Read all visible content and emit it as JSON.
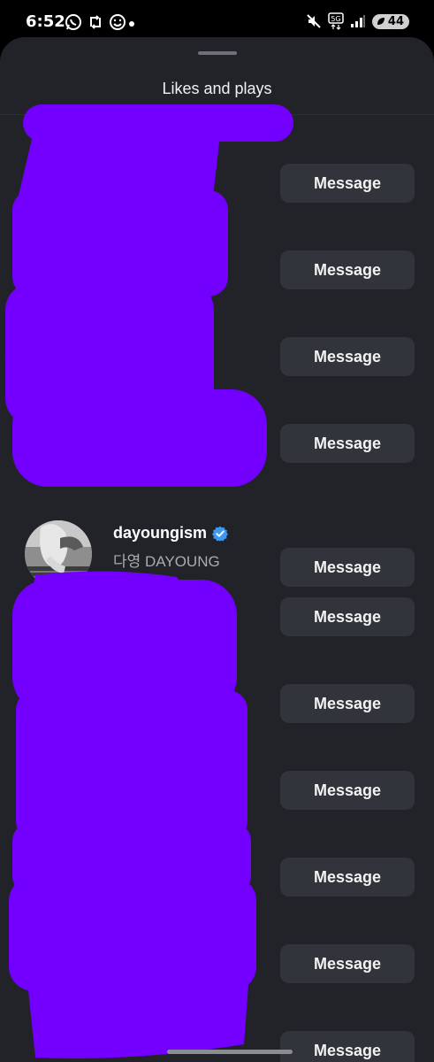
{
  "status_bar": {
    "time": "6:52",
    "battery": "44",
    "icons": [
      "whatsapp-icon",
      "retweet-icon",
      "smiley-icon",
      "mute-icon",
      "5g-icon",
      "signal-icon"
    ]
  },
  "sheet": {
    "title": "Likes and plays"
  },
  "rows": [
    {
      "message_label": "Message"
    },
    {
      "message_label": "Message"
    },
    {
      "message_label": "Message"
    },
    {
      "message_label": "Message"
    },
    {
      "username": "dayoungism",
      "display_name": "다영 DAYOUNG",
      "verified": true,
      "message_label": "Message"
    },
    {
      "message_label": "Message"
    },
    {
      "message_label": "Message"
    },
    {
      "message_label": "Message"
    },
    {
      "message_label": "Message"
    },
    {
      "message_label": "Message"
    },
    {
      "message_label": "Message"
    }
  ],
  "colors": {
    "sheet_bg": "#212328",
    "button_bg": "#31343a",
    "verified": "#3b9af0",
    "redaction": "#7300ff"
  }
}
